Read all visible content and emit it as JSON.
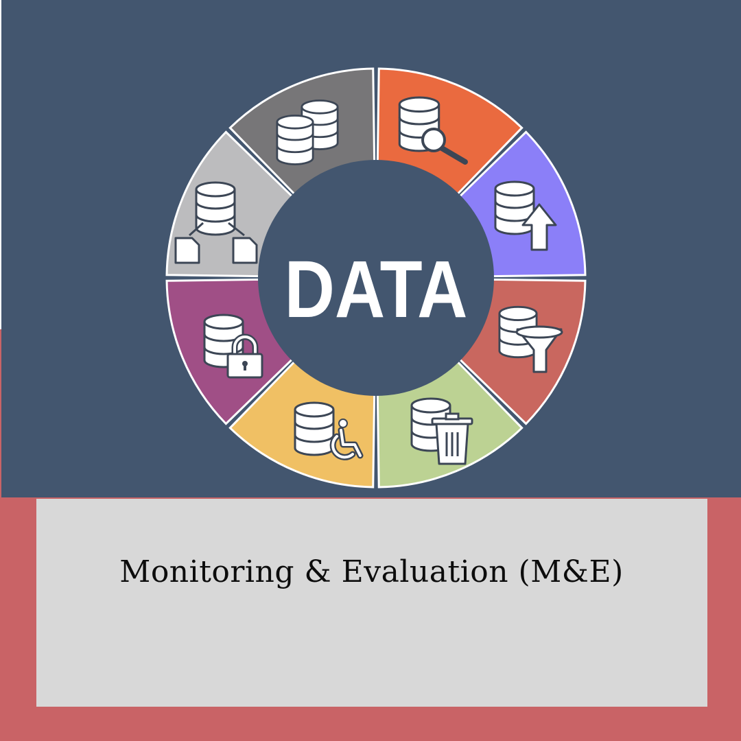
{
  "center_label": "DATA",
  "caption": "Monitoring & Evaluation (M&E)",
  "colors": {
    "background_top": "#43566f",
    "background_bottom": "#c96366",
    "caption_box": "#d8d8d8",
    "icon_fill": "#ffffff",
    "icon_stroke": "#3c4655"
  },
  "segments": [
    {
      "icon": "database-search-icon",
      "color": "#ea6a3f"
    },
    {
      "icon": "database-upload-icon",
      "color": "#8b7ff8"
    },
    {
      "icon": "database-filter-icon",
      "color": "#c9675f"
    },
    {
      "icon": "database-delete-icon",
      "color": "#bcd293"
    },
    {
      "icon": "database-accessibility-icon",
      "color": "#f0c064"
    },
    {
      "icon": "database-lock-icon",
      "color": "#a04f86"
    },
    {
      "icon": "database-share-icon",
      "color": "#bcbcbe"
    },
    {
      "icon": "database-stack-icon",
      "color": "#777678"
    }
  ]
}
